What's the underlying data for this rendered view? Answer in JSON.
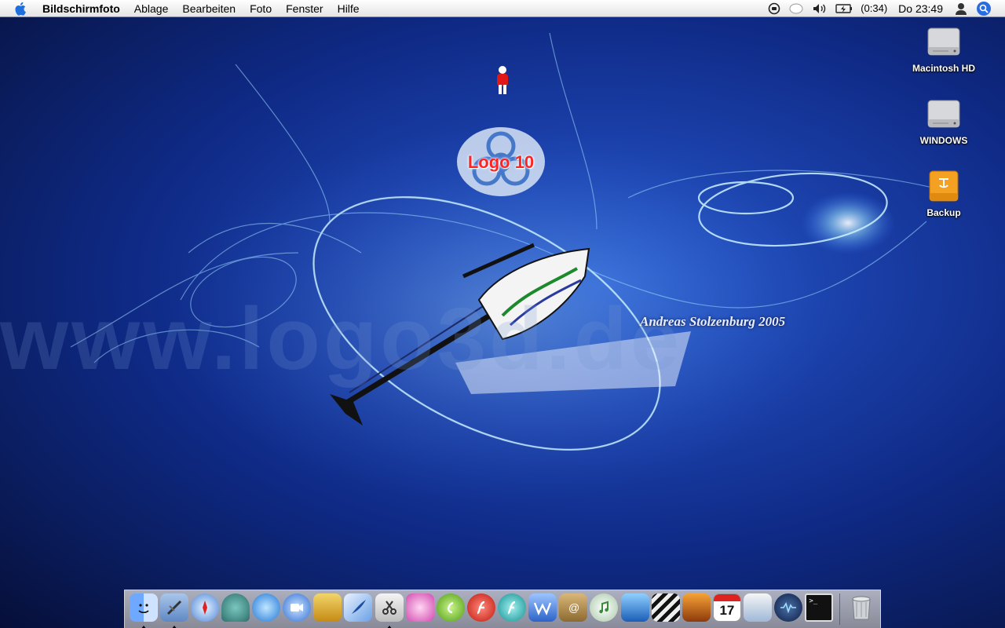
{
  "menubar": {
    "app_name": "Bildschirmfoto",
    "menus": [
      "Ablage",
      "Bearbeiten",
      "Foto",
      "Fenster",
      "Hilfe"
    ],
    "battery_time": "(0:34)",
    "clock": "Do 23:49",
    "status_icons": [
      "sync-icon",
      "speech-icon",
      "volume-icon",
      "battery-icon",
      "user-icon",
      "spotlight-icon"
    ]
  },
  "wallpaper": {
    "watermark": "www.logo3d.de",
    "signature": "Andreas Stolzenburg 2005",
    "logo_text": "Logo 10"
  },
  "desktop_icons": [
    {
      "label": "Macintosh HD",
      "icon": "hard-drive-icon"
    },
    {
      "label": "WINDOWS",
      "icon": "hard-drive-icon"
    },
    {
      "label": "Backup",
      "icon": "firewire-drive-icon"
    }
  ],
  "dock": {
    "apps": [
      {
        "icon": "finder-icon",
        "running": true
      },
      {
        "icon": "mail-icon",
        "running": true
      },
      {
        "icon": "safari-icon",
        "running": false
      },
      {
        "icon": "dashboard-icon",
        "running": false
      },
      {
        "icon": "network-globe-icon",
        "running": false
      },
      {
        "icon": "ichat-icon",
        "running": false
      },
      {
        "icon": "transmit-truck-icon",
        "running": false
      },
      {
        "icon": "quill-icon",
        "running": false
      },
      {
        "icon": "screenshot-scissors-icon",
        "running": true
      },
      {
        "icon": "iphoto-flower-icon",
        "running": false
      },
      {
        "icon": "dreamweaver-icon",
        "running": false
      },
      {
        "icon": "flash-icon",
        "running": false
      },
      {
        "icon": "fireworks-icon",
        "running": false
      },
      {
        "icon": "word-icon",
        "running": false
      },
      {
        "icon": "address-book-icon",
        "running": false
      },
      {
        "icon": "itunes-icon",
        "running": false
      },
      {
        "icon": "imovie-icon",
        "running": false
      },
      {
        "icon": "final-cut-icon",
        "running": false
      },
      {
        "icon": "photo-booth-icon",
        "running": false
      },
      {
        "icon": "ical-icon",
        "running": false
      },
      {
        "icon": "stuffit-icon",
        "running": false
      },
      {
        "icon": "network-utility-icon",
        "running": false
      },
      {
        "icon": "terminal-icon",
        "running": false
      }
    ],
    "ical_day": "17",
    "trash_icon": "trash-icon"
  }
}
